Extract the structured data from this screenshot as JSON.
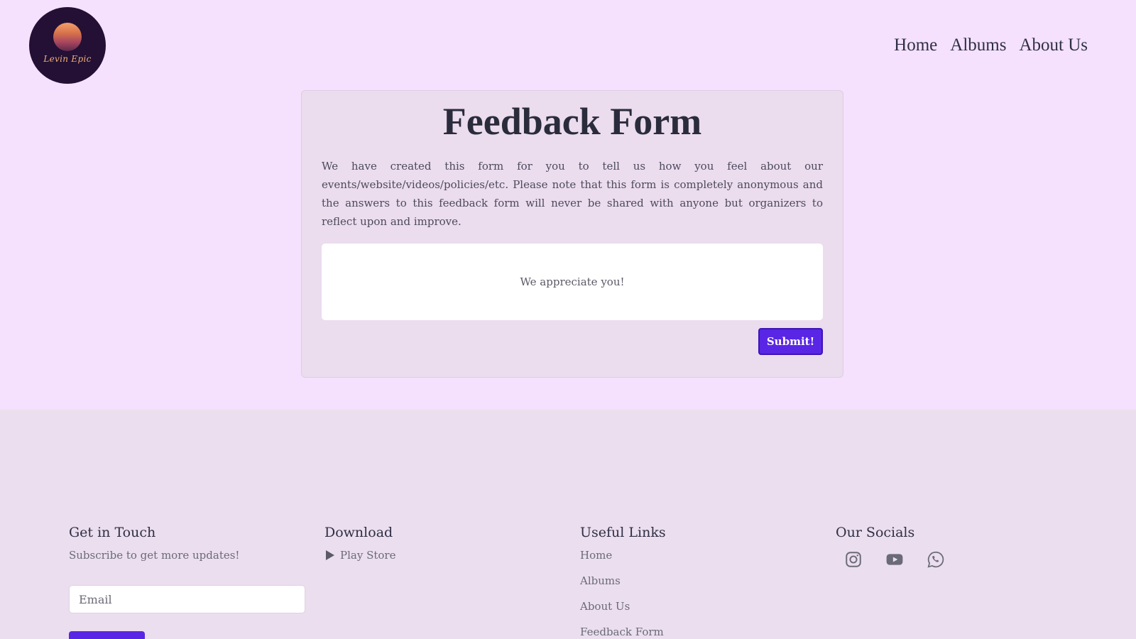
{
  "header": {
    "logo_text": "Levin Epic",
    "nav": [
      {
        "label": "Home"
      },
      {
        "label": "Albums"
      },
      {
        "label": "About Us"
      }
    ]
  },
  "feedback": {
    "title": "Feedback Form",
    "description": "We have created this form for you to tell us how you feel about our events/website/videos/policies/etc. Please note that this form is completely anonymous and the answers to this feedback form will never be shared with anyone but organizers to reflect upon and improve.",
    "placeholder": "We appreciate you!",
    "submit_label": "Submit!"
  },
  "footer": {
    "get_in_touch": {
      "heading": "Get in Touch",
      "subtext": "Subscribe to get more updates!",
      "email_placeholder": "Email",
      "button_label": ""
    },
    "download": {
      "heading": "Download",
      "link_label": "Play Store",
      "icon": "play-store-icon"
    },
    "useful_links": {
      "heading": "Useful Links",
      "links": [
        {
          "label": "Home"
        },
        {
          "label": "Albums"
        },
        {
          "label": "About Us"
        },
        {
          "label": "Feedback Form"
        }
      ]
    },
    "socials": {
      "heading": "Our Socials",
      "icons": [
        "instagram-icon",
        "youtube-icon",
        "whatsapp-icon"
      ]
    }
  },
  "colors": {
    "page_bg": "#f5e1fd",
    "card_bg": "#ebdcee",
    "footer_bg": "#ebdeee",
    "accent": "#5a26e5",
    "logo_bg": "#231034"
  }
}
